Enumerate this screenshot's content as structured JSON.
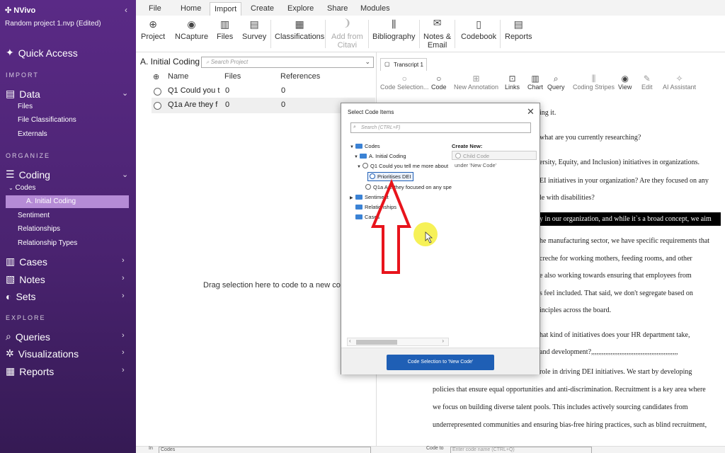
{
  "app": {
    "name": "NVivo",
    "project": "Random project 1.nvp (Edited)",
    "collapse_glyph": "‹"
  },
  "sidebar": {
    "quick_access": "Quick Access",
    "sections": {
      "import": "IMPORT",
      "organize": "ORGANIZE",
      "explore": "EXPLORE"
    },
    "data": {
      "label": "Data",
      "items": [
        "Files",
        "File Classifications",
        "Externals"
      ]
    },
    "coding": {
      "label": "Coding",
      "codes": "Codes",
      "active_item": "A. Initial Coding",
      "items": [
        "Sentiment",
        "Relationships",
        "Relationship Types"
      ]
    },
    "cases": "Cases",
    "notes": "Notes",
    "sets": "Sets",
    "queries": "Queries",
    "visualizations": "Visualizations",
    "reports": "Reports"
  },
  "ribbon": {
    "tabs": [
      "File",
      "Home",
      "Import",
      "Create",
      "Explore",
      "Share",
      "Modules"
    ],
    "active_tab": "Import",
    "buttons": [
      "Project",
      "NCapture",
      "Files",
      "Survey",
      "Classifications",
      "Add from Citavi",
      "Bibliography",
      "Notes & Email",
      "Codebook",
      "Reports"
    ],
    "add_from_line1": "Add from",
    "add_from_line2": "Citavi",
    "notes_line1": "Notes &",
    "notes_line2": "Email"
  },
  "left_panel": {
    "title": "A. Initial Coding",
    "search_placeholder": "Search Project",
    "columns": [
      "Name",
      "Files",
      "References"
    ],
    "rows": [
      {
        "name": "Q1 Could you t",
        "files": "0",
        "refs": "0"
      },
      {
        "name": "Q1a Are they f",
        "files": "0",
        "refs": "0"
      }
    ],
    "drag_hint": "Drag selection here to code to a new code"
  },
  "right_panel": {
    "doc_tab": "Transcript 1",
    "toolbar": [
      "Code Selection...",
      "Code",
      "New Annotation",
      "Links",
      "Chart",
      "Query",
      "Coding Stripes",
      "View",
      "Edit",
      "AI Assistant"
    ],
    "lines": [
      "ing it.",
      "what are you currently researching?",
      "ersity, Equity, and Inclusion) initiatives in organizations.",
      "EI initiatives in your organization? Are they focused on any",
      "le with disabilities?",
      "y in our organization, and while it`s a broad concept, we aim",
      "he manufacturing sector, we have specific requirements that",
      " creche for working mothers, feeding rooms, and other",
      "e also working towards ensuring that employees from",
      "s feel included. That said, we don't segregate based on",
      "inciples across the board.",
      "hat kind of initiatives does your HR department take,",
      "and development?,,,,,,,,,,,,,,,,,,,,,,,,,,,,,,,,,,,,,,,,,,,,,,,,,",
      "role in driving DEI initiatives. We start by developing",
      "policies that ensure equal opportunities and anti-discrimination. Recruitment is a key area where",
      "we focus on building diverse talent pools. This includes actively sourcing candidates from",
      "underrepresented communities and ensuring bias-free hiring practices, such as blind recruitment,"
    ]
  },
  "dialog": {
    "title": "Select Code Items",
    "search_placeholder": "Search (CTRL+F)",
    "tree": {
      "codes": "Codes",
      "initial_coding": "A. Initial Coding",
      "q1": "Q1 Could you tell me more about",
      "selected": "Prioritises DEI",
      "q1a": "Q1a Are they focused on any spe",
      "sentiment": "Sentiment",
      "relationships": "Relationships",
      "cases": "Cases"
    },
    "create_new": "Create New:",
    "child_code_placeholder": "Child Code",
    "under_label": "under 'New Code'",
    "button": "Code Selection to 'New Code'"
  },
  "bottom": {
    "in_label": "In",
    "in_value": "Codes",
    "code_to": "Code to",
    "code_to_placeholder": "Enter code name (CTRL+Q)"
  },
  "colors": {
    "sidebar": "#4a2370",
    "sidebar_active": "#b58bd6",
    "primary_button": "#1f5fb5",
    "annotation_arrow": "#e8141c",
    "cursor_highlight": "#f5ee3a"
  }
}
